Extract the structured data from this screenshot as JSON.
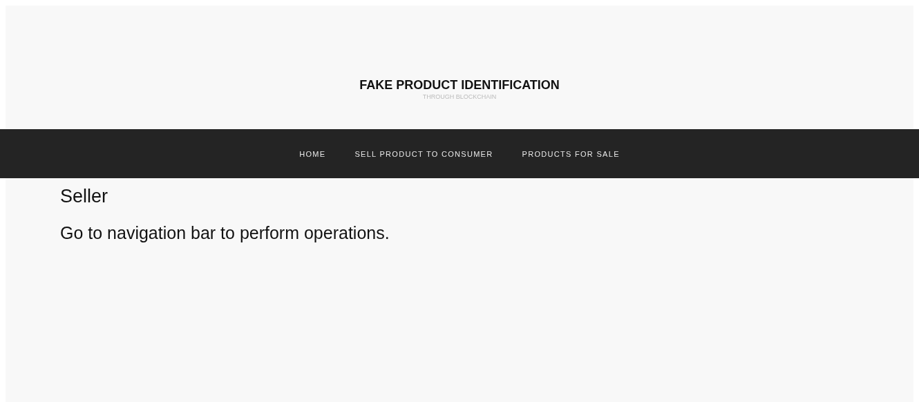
{
  "header": {
    "title": "FAKE PRODUCT IDENTIFICATION",
    "subtitle": "THROUGH BLOCKCHAIN"
  },
  "nav": [
    {
      "label": "HOME"
    },
    {
      "label": "SELL PRODUCT TO CONSUMER"
    },
    {
      "label": "PRODUCTS FOR SALE"
    }
  ],
  "content": {
    "heading": "Seller",
    "message": "Go to navigation bar to perform operations."
  }
}
